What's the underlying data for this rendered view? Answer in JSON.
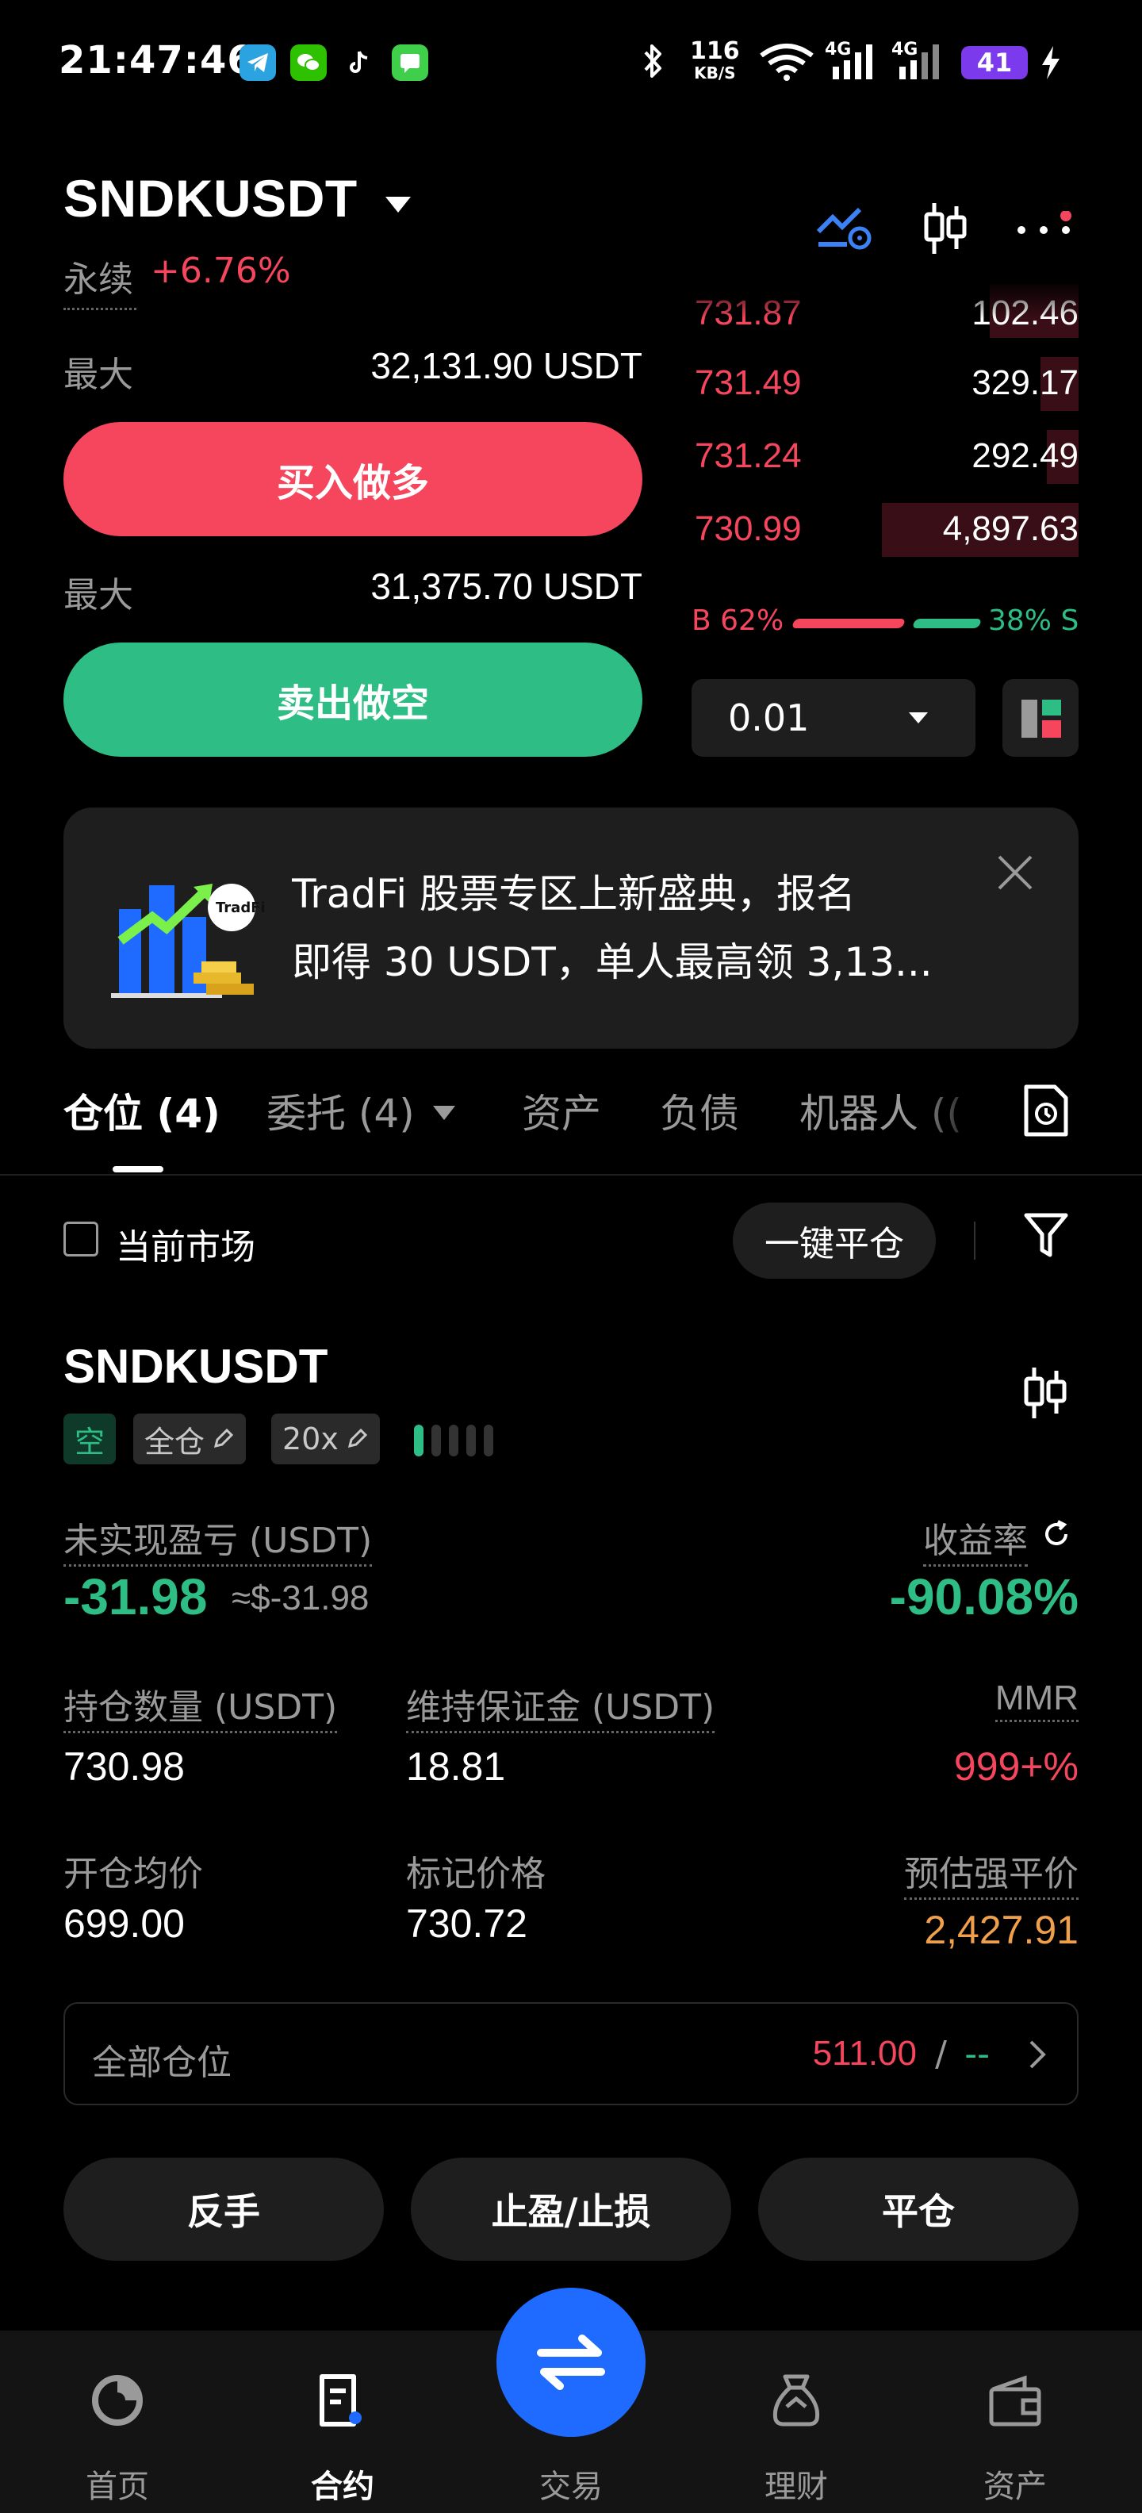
{
  "status_bar": {
    "time": "21:47:46",
    "net_speed_value": "116",
    "net_speed_unit": "KB/S",
    "signal1": "4G",
    "signal2": "4G",
    "battery": "41"
  },
  "header": {
    "pair": "SNDKUSDT",
    "perp_label": "永续",
    "change_pct": "+6.76%"
  },
  "orderbook": {
    "asks": [
      {
        "price": "731.87",
        "qty": "102.46"
      },
      {
        "price": "731.49",
        "qty": "329.17"
      },
      {
        "price": "731.24",
        "qty": "292.49"
      },
      {
        "price": "730.99",
        "qty": "4,897.63"
      }
    ],
    "buy_ratio_label": "B 62%",
    "sell_ratio_label": "38% S",
    "buy_ratio": 0.62,
    "precision": "0.01"
  },
  "order_panel": {
    "max_label": "最大",
    "buy_max": "32,131.90 USDT",
    "buy_button": "买入做多",
    "sell_max": "31,375.70 USDT",
    "sell_button": "卖出做空"
  },
  "banner": {
    "line1": "TradFi 股票专区上新盛典，报名",
    "line2": "即得 30 USDT，单人最高领 3,13...",
    "badge": "TradFi"
  },
  "tabs": [
    {
      "label": "仓位 (4)"
    },
    {
      "label": "委托 (4)"
    },
    {
      "label": "资产"
    },
    {
      "label": "负债"
    },
    {
      "label": "机器人 (("
    }
  ],
  "filter_bar": {
    "current_market": "当前市场",
    "close_all": "一键平仓"
  },
  "position": {
    "symbol": "SNDKUSDT",
    "side": "空",
    "margin_mode": "全仓",
    "leverage": "20x",
    "unrealized_pnl_label": "未实现盈亏 (USDT)",
    "unrealized_pnl": "-31.98",
    "unrealized_pnl_usd": "≈$-31.98",
    "roe_label": "收益率",
    "roe": "-90.08%",
    "size_label": "持仓数量 (USDT)",
    "size": "730.98",
    "maint_margin_label": "维持保证金 (USDT)",
    "maint_margin": "18.81",
    "mmr_label": "MMR",
    "mmr": "999+%",
    "entry_label": "开仓均价",
    "entry": "699.00",
    "mark_label": "标记价格",
    "mark": "730.72",
    "liq_label": "预估强平价",
    "liq": "2,427.91",
    "all_positions_label": "全部仓位",
    "all_positions_value": "511.00",
    "all_positions_sep": "/",
    "all_positions_value2": "--",
    "buttons": {
      "reverse": "反手",
      "tpsl": "止盈/止损",
      "close": "平仓"
    }
  },
  "bottom_nav": [
    {
      "label": "首页",
      "icon": "home-icon"
    },
    {
      "label": "合约",
      "icon": "contract-icon"
    },
    {
      "label": "交易",
      "icon": "swap-icon"
    },
    {
      "label": "理财",
      "icon": "earn-icon"
    },
    {
      "label": "资产",
      "icon": "wallet-icon"
    }
  ],
  "colors": {
    "red": "#f6465d",
    "green": "#2ebd85",
    "orange": "#f0a04b",
    "blue": "#1f6bff"
  }
}
